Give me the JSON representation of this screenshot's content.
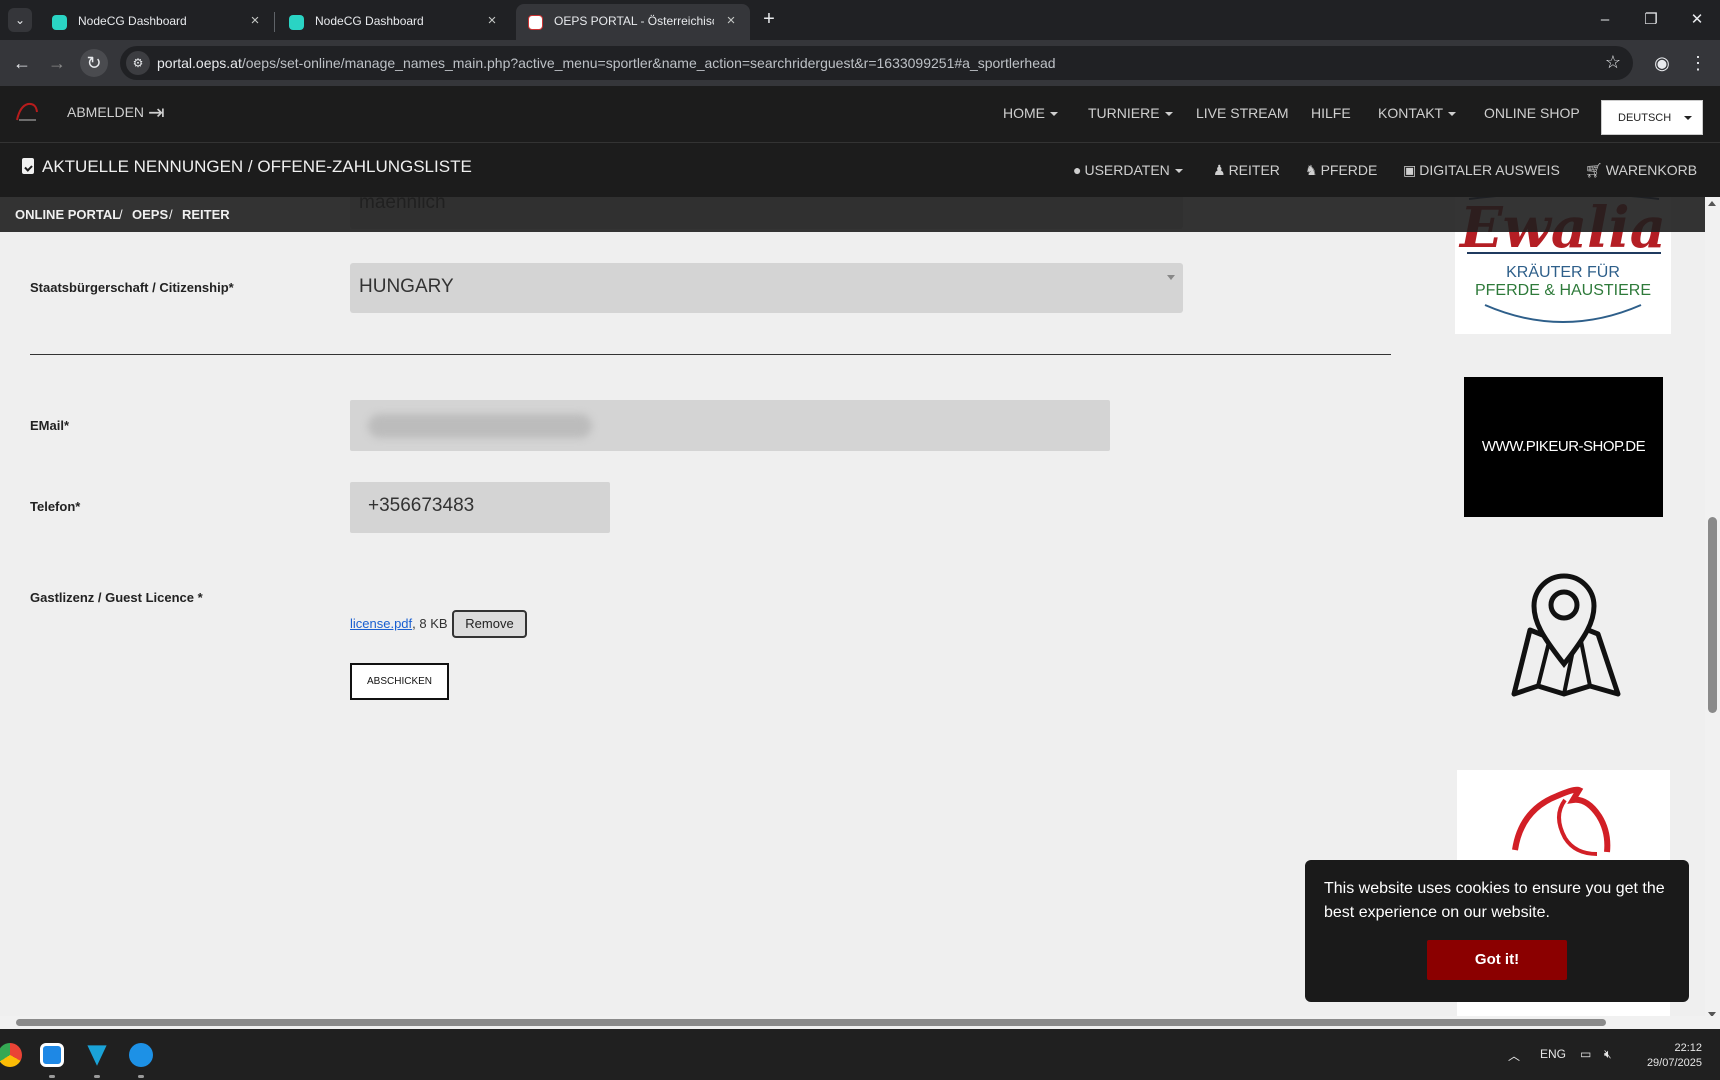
{
  "browser": {
    "tabs": [
      {
        "title": "NodeCG Dashboard",
        "active": false
      },
      {
        "title": "NodeCG Dashboard",
        "active": false
      },
      {
        "title": "OEPS PORTAL - Österreichischer",
        "active": true
      }
    ],
    "url_host": "portal.oeps.at",
    "url_path": "/oeps/set-online/manage_names_main.php?active_menu=sportler&name_action=searchriderguest&r=1633099251#a_sportlerhead"
  },
  "site_header": {
    "logout_label": "ABMELDEN",
    "nav": [
      {
        "label": "HOME",
        "dropdown": true
      },
      {
        "label": "TURNIERE",
        "dropdown": true
      },
      {
        "label": "LIVE STREAM",
        "dropdown": false
      },
      {
        "label": "HILFE",
        "dropdown": false
      },
      {
        "label": "KONTAKT",
        "dropdown": true
      },
      {
        "label": "ONLINE SHOP",
        "dropdown": false
      }
    ],
    "language": "DEUTSCH"
  },
  "sub_header": {
    "title": "AKTUELLE NENNUNGEN / OFFENE-ZAHLUNGSLISTE",
    "nav": [
      {
        "label": "USERDATEN",
        "icon": "user-circle-icon"
      },
      {
        "label": "REITER",
        "icon": "person-icon"
      },
      {
        "label": "PFERDE",
        "icon": "horse-head-icon"
      },
      {
        "label": "DIGITALER AUSWEIS",
        "icon": "id-card-icon"
      },
      {
        "label": "WARENKORB",
        "icon": "cart-icon"
      }
    ]
  },
  "breadcrumb": [
    "ONLINE PORTAL",
    "OEPS",
    "REITER"
  ],
  "form": {
    "gender_value": "maennlich",
    "citizenship_label": "Staatsbürgerschaft / Citizenship*",
    "citizenship_value": "HUNGARY",
    "email_label": "EMail*",
    "phone_label": "Telefon*",
    "phone_value": "+356673483",
    "licence_label": "Gastlizenz / Guest Licence *",
    "file_name": "license.pdf",
    "file_size": ", 8 KB",
    "remove_label": "Remove",
    "submit_label": "ABSCHICKEN"
  },
  "ads": {
    "ewalia_brand": "Ewalia",
    "ewalia_line1": "KRÄUTER FÜR",
    "ewalia_line2": "PFERDE & HAUSTIERE",
    "pikeur": "WWW.PIKEUR-SHOP.DE"
  },
  "cookie": {
    "text": "This website uses cookies to ensure you get the best experience on our website.",
    "button": "Got it!"
  },
  "taskbar": {
    "lang": "ENG",
    "time": "22:12",
    "date": "29/07/2025"
  },
  "colors": {
    "header_bg": "#1c1c1c",
    "accent_red": "#8b0000",
    "field_bg": "#d4d4d4"
  }
}
